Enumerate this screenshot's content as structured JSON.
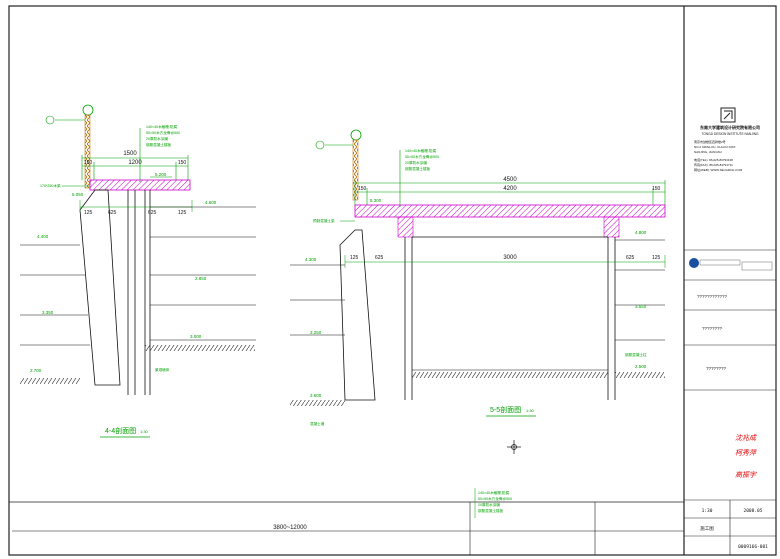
{
  "colors": {
    "frame": "#222222",
    "structure": "#111111",
    "dimension": "#00a000",
    "annotation": "#00b000",
    "slab_hatch": "#cc00cc",
    "signature": "#e00000",
    "logo_blue": "#1a4fa0",
    "background": "#ffffff"
  },
  "section_left": {
    "title": "4-4剖面图",
    "scale": "1:30",
    "dim_top": "1500",
    "dim_mid": "1200",
    "dim_l": "150",
    "dim_r": "150",
    "dim_b1": "125",
    "dim_b2": "625",
    "dim_b3": "625",
    "dim_b4": "125",
    "el_slab": "5.200",
    "el_left": "5.050",
    "el_right": "4.600",
    "el_wall": "4.400",
    "el_2": "2.850",
    "el_3": "3.350",
    "el_4": "2.700",
    "el_ground": "3.000",
    "note_beam": "170*250木梁",
    "note_wall": "景观墙体",
    "notes": [
      "140×40木格栅,防腐",
      "50×50木方龙骨@500",
      "20厚防水涂膜",
      "钢筋混凝土楼板"
    ]
  },
  "section_right": {
    "title": "5-5剖面图",
    "scale": "1:30",
    "dim_top": "4500",
    "dim_mid": "4200",
    "dim_l": "150",
    "dim_r": "150",
    "dim_span": "3000",
    "dim_b1": "125",
    "dim_b2": "625",
    "dim_b3": "625",
    "dim_b4": "125",
    "el_slab": "5.300",
    "el_right": "4.800",
    "el_left": "4.300",
    "el_1": "3.550",
    "el_2": "3.250",
    "el_3": "3.300",
    "el_4": "2.500",
    "el_5": "3.600",
    "note_beam": "预制混凝土梁",
    "note_wall": "混凝土墙",
    "note_wall2": "钢筋混凝土柱",
    "notes": [
      "140×40木格栅,防腐",
      "50×50木方龙骨@500",
      "20厚防水涂膜",
      "钢筋混凝土楼板"
    ]
  },
  "bottom_notes": [
    "140×40木格栅,防腐",
    "50×50木方龙骨@500",
    "20厚防水涂膜",
    "钢筋混凝土楼板"
  ],
  "bottom_dim": "3800~12000",
  "title_block": {
    "company_cn": "东南大学建筑设计研究院有限公司",
    "company_en": "TONGJI DESIGN INSTITUTE NANJING",
    "address1": "南京市鼓楼区四牌楼2号",
    "address2": "NO.2 SIPAILOU, GULOU DIST.",
    "address3": "NANJING, JIANGSU",
    "tel": "电话(TEL): 86-025-83793138",
    "fax": "传真(FAX): 86-025-83791711",
    "web": "网址(WEB): WWW.SEUARCH.COM",
    "project_label": "????????????",
    "drawing_label1": "????????",
    "drawing_label2": "????????",
    "sign1": "沈兆成",
    "sign2": "柯秀萍",
    "sign3": "高振宇",
    "scale": "1:30",
    "date": "2008.05",
    "stage": "施工图",
    "drawing_no": "0009166-001"
  }
}
